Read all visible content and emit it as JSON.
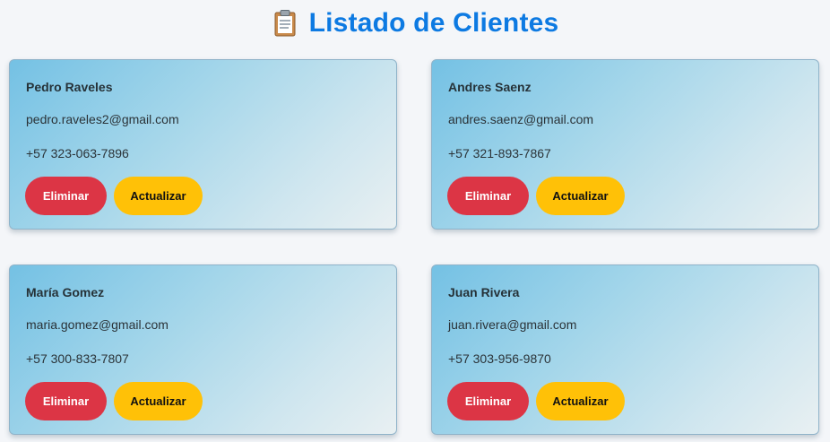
{
  "header": {
    "title": "Listado de Clientes",
    "icon": "clipboard-icon"
  },
  "colors": {
    "title": "#0d7ae2",
    "delete_button": "#dc3545",
    "update_button": "#ffc107"
  },
  "clients": [
    {
      "name": "Pedro Raveles",
      "email": "pedro.raveles2@gmail.com",
      "phone": "+57 323-063-7896",
      "delete_label": "Eliminar",
      "update_label": "Actualizar"
    },
    {
      "name": "Andres Saenz",
      "email": "andres.saenz@gmail.com",
      "phone": "+57 321-893-7867",
      "delete_label": "Eliminar",
      "update_label": "Actualizar"
    },
    {
      "name": "María Gomez",
      "email": "maria.gomez@gmail.com",
      "phone": "+57 300-833-7807",
      "delete_label": "Eliminar",
      "update_label": "Actualizar"
    },
    {
      "name": "Juan Rivera",
      "email": "juan.rivera@gmail.com",
      "phone": "+57 303-956-9870",
      "delete_label": "Eliminar",
      "update_label": "Actualizar"
    }
  ]
}
